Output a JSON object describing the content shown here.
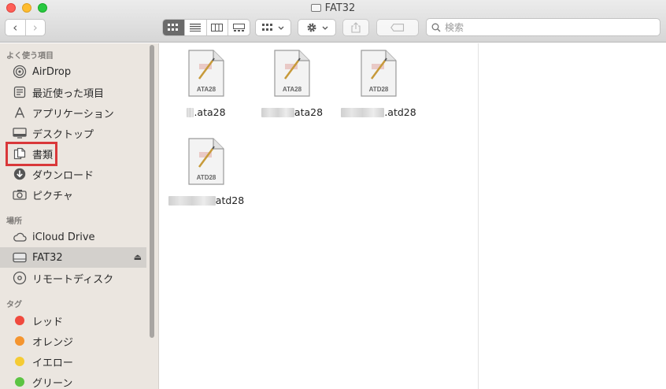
{
  "window": {
    "title": "FAT32"
  },
  "toolbar": {
    "back_glyph": "‹",
    "forward_glyph": "›",
    "search_placeholder": "検索"
  },
  "sidebar": {
    "favorites_header": "よく使う項目",
    "favorites": [
      {
        "label": "AirDrop",
        "icon": "airdrop-icon"
      },
      {
        "label": "最近使った項目",
        "icon": "recents-icon"
      },
      {
        "label": "アプリケーション",
        "icon": "applications-icon"
      },
      {
        "label": "デスクトップ",
        "icon": "desktop-icon"
      },
      {
        "label": "書類",
        "icon": "documents-icon"
      },
      {
        "label": "ダウンロード",
        "icon": "downloads-icon"
      },
      {
        "label": "ピクチャ",
        "icon": "pictures-icon"
      }
    ],
    "locations_header": "場所",
    "locations": [
      {
        "label": "iCloud Drive",
        "icon": "cloud-icon"
      },
      {
        "label": "FAT32",
        "icon": "drive-icon",
        "selected": true,
        "eject": "⏏"
      },
      {
        "label": "リモートディスク",
        "icon": "disc-icon"
      }
    ],
    "tags_header": "タグ",
    "tags": [
      {
        "label": "レッド",
        "color": "#f04a3e"
      },
      {
        "label": "オレンジ",
        "color": "#f4952f"
      },
      {
        "label": "イエロー",
        "color": "#f5cb34"
      },
      {
        "label": "グリーン",
        "color": "#5cc443"
      }
    ]
  },
  "files": [
    {
      "badge": "ATA28",
      "name": ".ata28"
    },
    {
      "badge": "ATA28",
      "name": "ata28"
    },
    {
      "badge": "ATD28",
      "name": ".atd28"
    },
    {
      "badge": "ATD28",
      "name": "atd28"
    }
  ]
}
